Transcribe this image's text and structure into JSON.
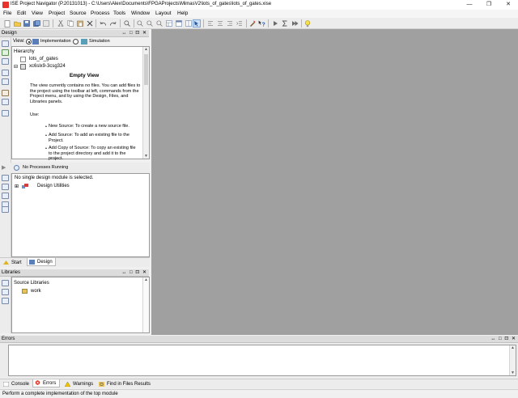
{
  "window": {
    "title": "ISE Project Navigator (P.20131013) - C:\\Users\\Alex\\Documents\\FPGAProjects\\MimasV2\\lots_of_gates\\lots_of_gates.xise",
    "minimize": "—",
    "maximize": "❐",
    "close": "✕"
  },
  "menu": [
    "File",
    "Edit",
    "View",
    "Project",
    "Source",
    "Process",
    "Tools",
    "Window",
    "Layout",
    "Help"
  ],
  "design_panel": {
    "title": "Design",
    "header_buttons": "↔ □ ⊡ ✕",
    "view_label": "View:",
    "view_options": [
      "Implementation",
      "Simulation"
    ],
    "hierarchy_label": "Hierarchy",
    "tree": {
      "project": "lots_of_gates",
      "device": "xc6slx9-3csg324"
    },
    "empty_view": {
      "title": "Empty View",
      "paragraph": "The view currently contains no files. You can add files to the project using the toolbar at left, commands from the Project menu, and by using the Design, Files, and Libraries panels.",
      "use_label": "Use:",
      "bullets": [
        "New Source: To create a new source file.",
        "Add Source: To add an existing file to the Project.",
        "Add Copy of Source: To copy an existing file to the project directory and add it to the project."
      ]
    }
  },
  "processes_panel": {
    "status": "No Processes Running",
    "message": "No single design module is selected.",
    "tree_item": "Design Utilities"
  },
  "bottom_tabs": [
    "Start",
    "Design"
  ],
  "libraries_panel": {
    "title": "Libraries",
    "header_buttons": "↔ □ ⊡ ✕",
    "root": "Source Libraries",
    "child": "work"
  },
  "errors_panel": {
    "title": "Errors",
    "header_buttons": "↔ □ ⊡ ✕"
  },
  "console_tabs": [
    "Console",
    "Errors",
    "Warnings",
    "Find in Files Results"
  ],
  "status_bar": "Perform a complete implementation of the top module"
}
